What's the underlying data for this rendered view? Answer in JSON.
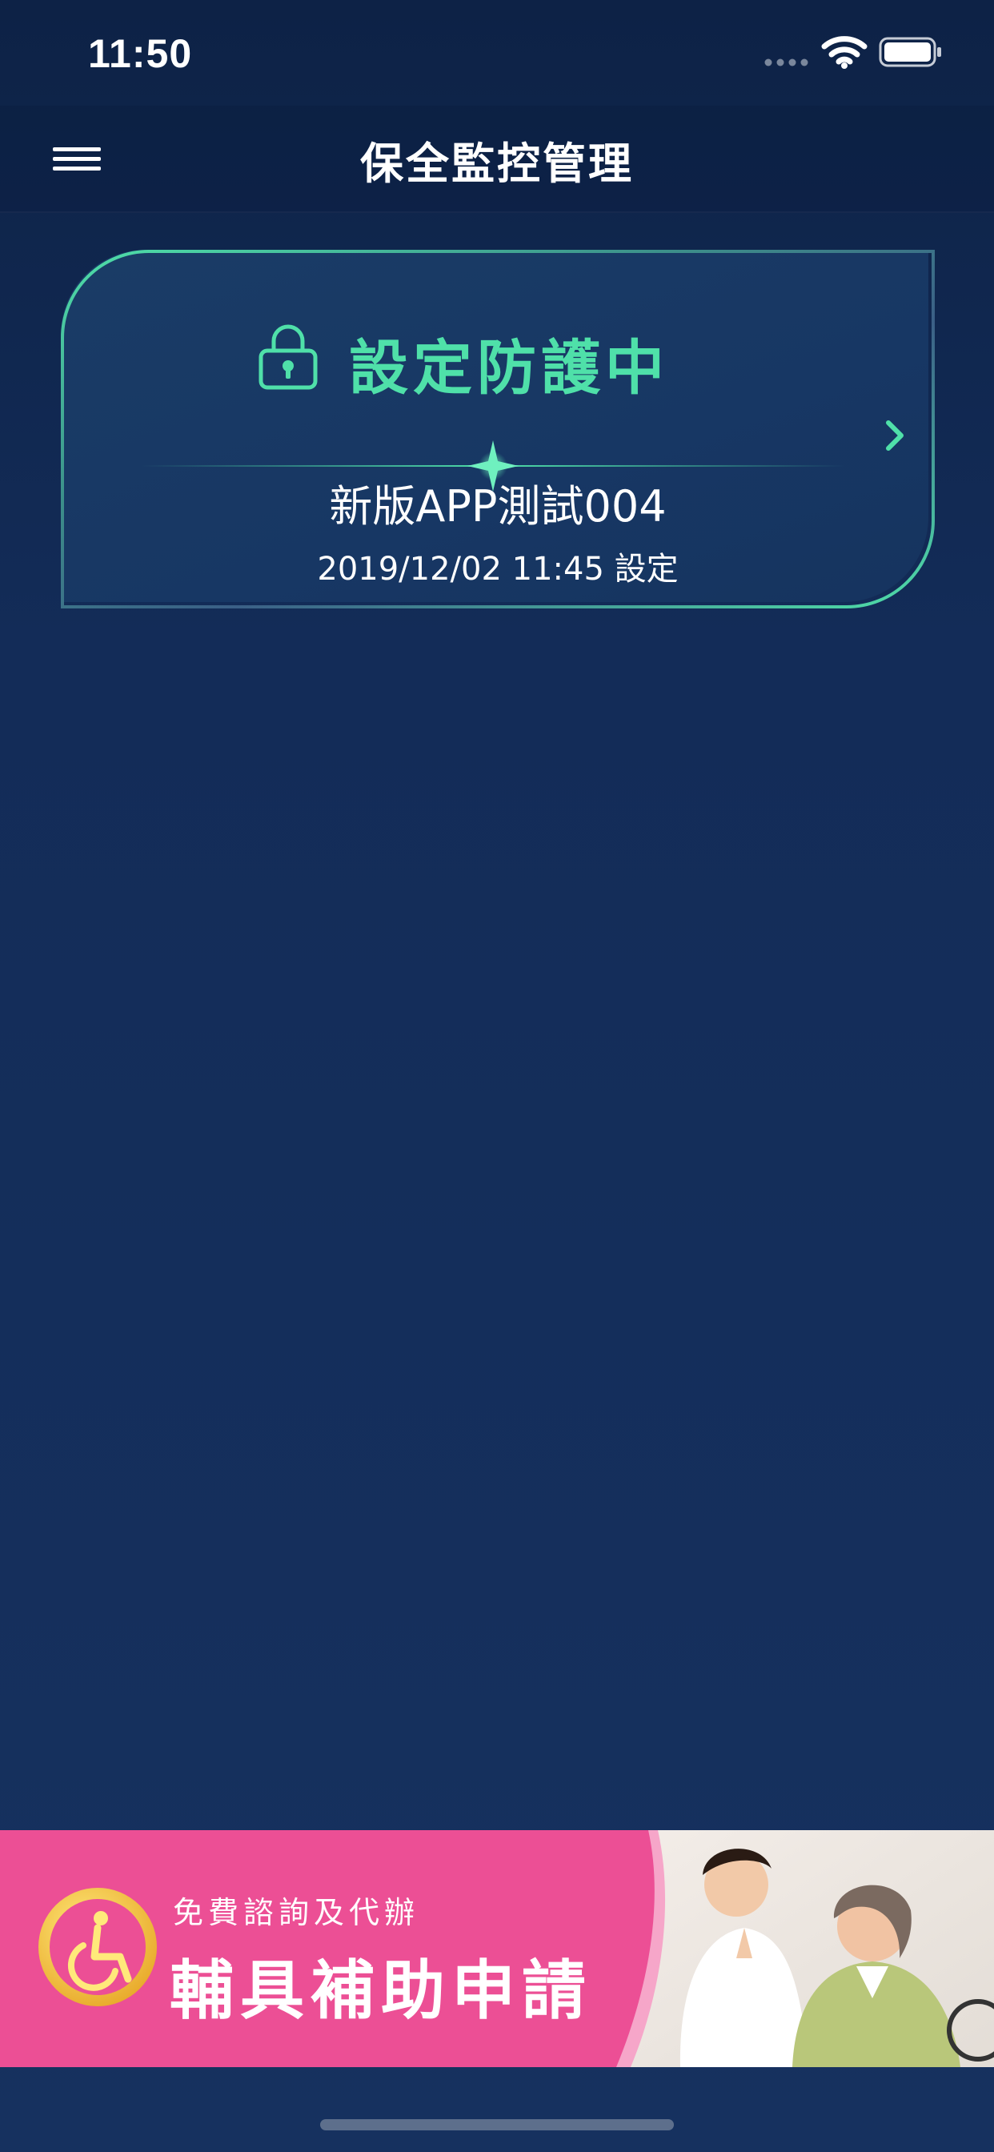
{
  "status_bar": {
    "time": "11:50"
  },
  "nav": {
    "title": "保全監控管理",
    "menu_icon": "hamburger-icon"
  },
  "card": {
    "status": "設定防護中",
    "device_name": "新版APP測試004",
    "set_time": "2019/12/02 11:45 設定",
    "icon": "lock-icon",
    "accent_color": "#4fe0a9"
  },
  "ad": {
    "subtitle": "免費諮詢及代辦",
    "title": "輔具補助申請",
    "icon": "wheelchair-icon",
    "bg_color": "#ec4f95"
  },
  "colors": {
    "background": "#132c58",
    "accent": "#4fe0a9"
  }
}
